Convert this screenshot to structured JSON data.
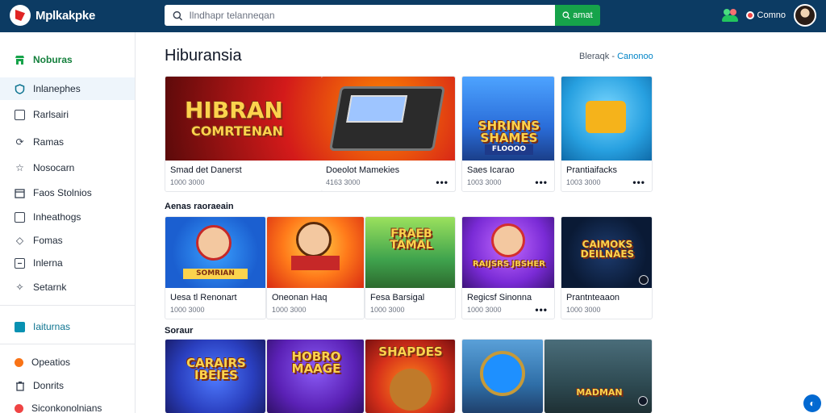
{
  "app": {
    "logo_text": "Mplkakpke"
  },
  "search": {
    "placeholder": "Ilndhapr telanneqan",
    "button_label": "amat"
  },
  "header": {
    "account_label": "Comno"
  },
  "sidebar": {
    "items": [
      {
        "label": "Noburas",
        "icon": "store-icon"
      },
      {
        "label": "Inlanephes",
        "icon": "shield-icon"
      },
      {
        "label": "Rarlsairi",
        "icon": "square-icon"
      },
      {
        "label": "Ramas",
        "icon": "refresh-icon"
      },
      {
        "label": "Nosocarn",
        "icon": "star-icon"
      },
      {
        "label": "Faos Stolnios",
        "icon": "calendar-icon"
      },
      {
        "label": "Inheathogs",
        "icon": "box-icon"
      },
      {
        "label": "Fomas",
        "icon": "diamond-icon"
      },
      {
        "label": "Inlerna",
        "icon": "list-icon"
      },
      {
        "label": "Setarnk",
        "icon": "settings-icon"
      }
    ],
    "section": {
      "label": "Iaiturnas",
      "icon": "library-icon"
    },
    "bottom_items": [
      {
        "label": "Opeatios",
        "icon": "orange-dot-icon"
      },
      {
        "label": "Donrits",
        "icon": "trash-icon"
      },
      {
        "label": "Siconkonolnians",
        "icon": "red-dot-icon"
      }
    ]
  },
  "main": {
    "title": "Hiburansia",
    "link_prefix": "Bleraqk -",
    "link_label": "Canonoo"
  },
  "row1": {
    "cards": [
      {
        "title": "Smad det Danerst",
        "meta": "1000 3000",
        "thumb_text": "HIBRAN",
        "thumb_sub": "COMRTENAN"
      },
      {
        "title": "Doeolot Mamekies",
        "meta": "4163 3000",
        "thumb_text": ""
      },
      {
        "title": "Saes Icarao",
        "meta": "1003 3000",
        "thumb_text": "SHRINNS SHAMES",
        "thumb_sub": "FLOOOO"
      },
      {
        "title": "Prantiaifacks",
        "meta": "1003 3000",
        "thumb_text": ""
      }
    ]
  },
  "row2": {
    "label": "Aenas raoraeain",
    "cards": [
      {
        "title": "Uesa tl Renonart",
        "meta": "1000 3000",
        "thumb_text": "SOMRIAN"
      },
      {
        "title": "Oneonan Haq",
        "meta": "1000 3000",
        "thumb_text": ""
      },
      {
        "title": "Fesa Barsigal",
        "meta": "1000 3000",
        "thumb_text": "FRAEB TAMAL"
      },
      {
        "title": "Regicsf Sinonna",
        "meta": "1000 3000",
        "thumb_text": "RAIJSRS JBSHER"
      },
      {
        "title": "Prantnteaaon",
        "meta": "1000 3000",
        "thumb_text": "CAIMOKS DEILNAES"
      }
    ]
  },
  "row3": {
    "label": "Soraur",
    "cards": [
      {
        "title": "",
        "meta": "",
        "thumb_text": "CARAIRS IBEIES"
      },
      {
        "title": "",
        "meta": "",
        "thumb_text": "HOBRO MAAGE"
      },
      {
        "title": "",
        "meta": "",
        "thumb_text": "SHAPDES"
      },
      {
        "title": "",
        "meta": "",
        "thumb_text": ""
      },
      {
        "title": "",
        "meta": "",
        "thumb_text": "MADMAN"
      }
    ]
  },
  "colors": {
    "topbar": "#0c3b63",
    "accent_green": "#16a34a",
    "link_blue": "#0284c7"
  }
}
